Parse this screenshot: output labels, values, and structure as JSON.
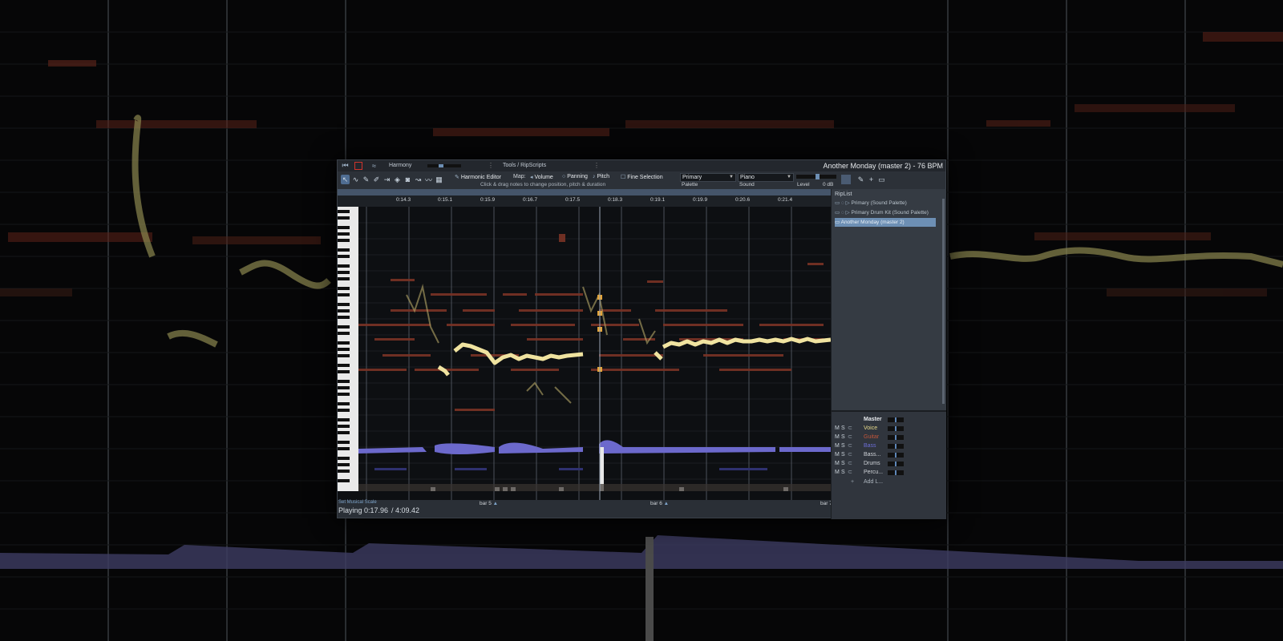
{
  "window": {
    "title": "Another Monday (master 2) - 76 BPM"
  },
  "topbar": {
    "harmony_label": "Harmony",
    "menu_label": "Tools / RipScripts"
  },
  "toolbar": {
    "harmonic_editor_label": "Harmonic Editor",
    "map_label": "Map:",
    "volume_label": "Volume",
    "panning_label": "Panning",
    "pitch_label": "Pitch",
    "fine_selection_label": "Fine Selection",
    "hint": "Click & drag notes to change position, pitch & duration",
    "palette_value": "Primary",
    "palette_label": "Palette",
    "sound_value": "Piano",
    "sound_label": "Sound",
    "level_label": "Level",
    "level_value": "0 dB"
  },
  "ruler": {
    "times": [
      "0:14.3",
      "0:15.1",
      "0:15.9",
      "0:16.7",
      "0:17.5",
      "0:18.3",
      "0:19.1",
      "0:19.9",
      "0:20.6",
      "0:21.4"
    ]
  },
  "bottom": {
    "scale_link": "Set Musical Scale",
    "playing_label": "Playing 0:17.96",
    "total_time": "/ 4:09.42",
    "bars": [
      "bar 5",
      "bar 6",
      "bar 7"
    ]
  },
  "riplist": {
    "title": "RipList",
    "items": [
      {
        "label": "Primary (Sound Palette)"
      },
      {
        "label": "Primary Drum Kit (Sound Palette)"
      },
      {
        "label": "Another Monday (master 2)"
      }
    ]
  },
  "mixer": {
    "master_label": "Master",
    "add_label": "Add L...",
    "tracks": [
      {
        "name": "Voice",
        "color": "#e6d98a"
      },
      {
        "name": "Guitar",
        "color": "#c0553a"
      },
      {
        "name": "Bass",
        "color": "#6d6fd8"
      },
      {
        "name": "Bass...",
        "color": "#cfd3d8"
      },
      {
        "name": "Drums",
        "color": "#cfd3d8"
      },
      {
        "name": "Percu...",
        "color": "#cfd3d8"
      }
    ],
    "mute": "M",
    "solo": "S"
  },
  "colors": {
    "voice": "#f2e7a0",
    "guitar": "#a24a36",
    "bass": "#7c79e0",
    "selection": "#6d8fb4"
  }
}
